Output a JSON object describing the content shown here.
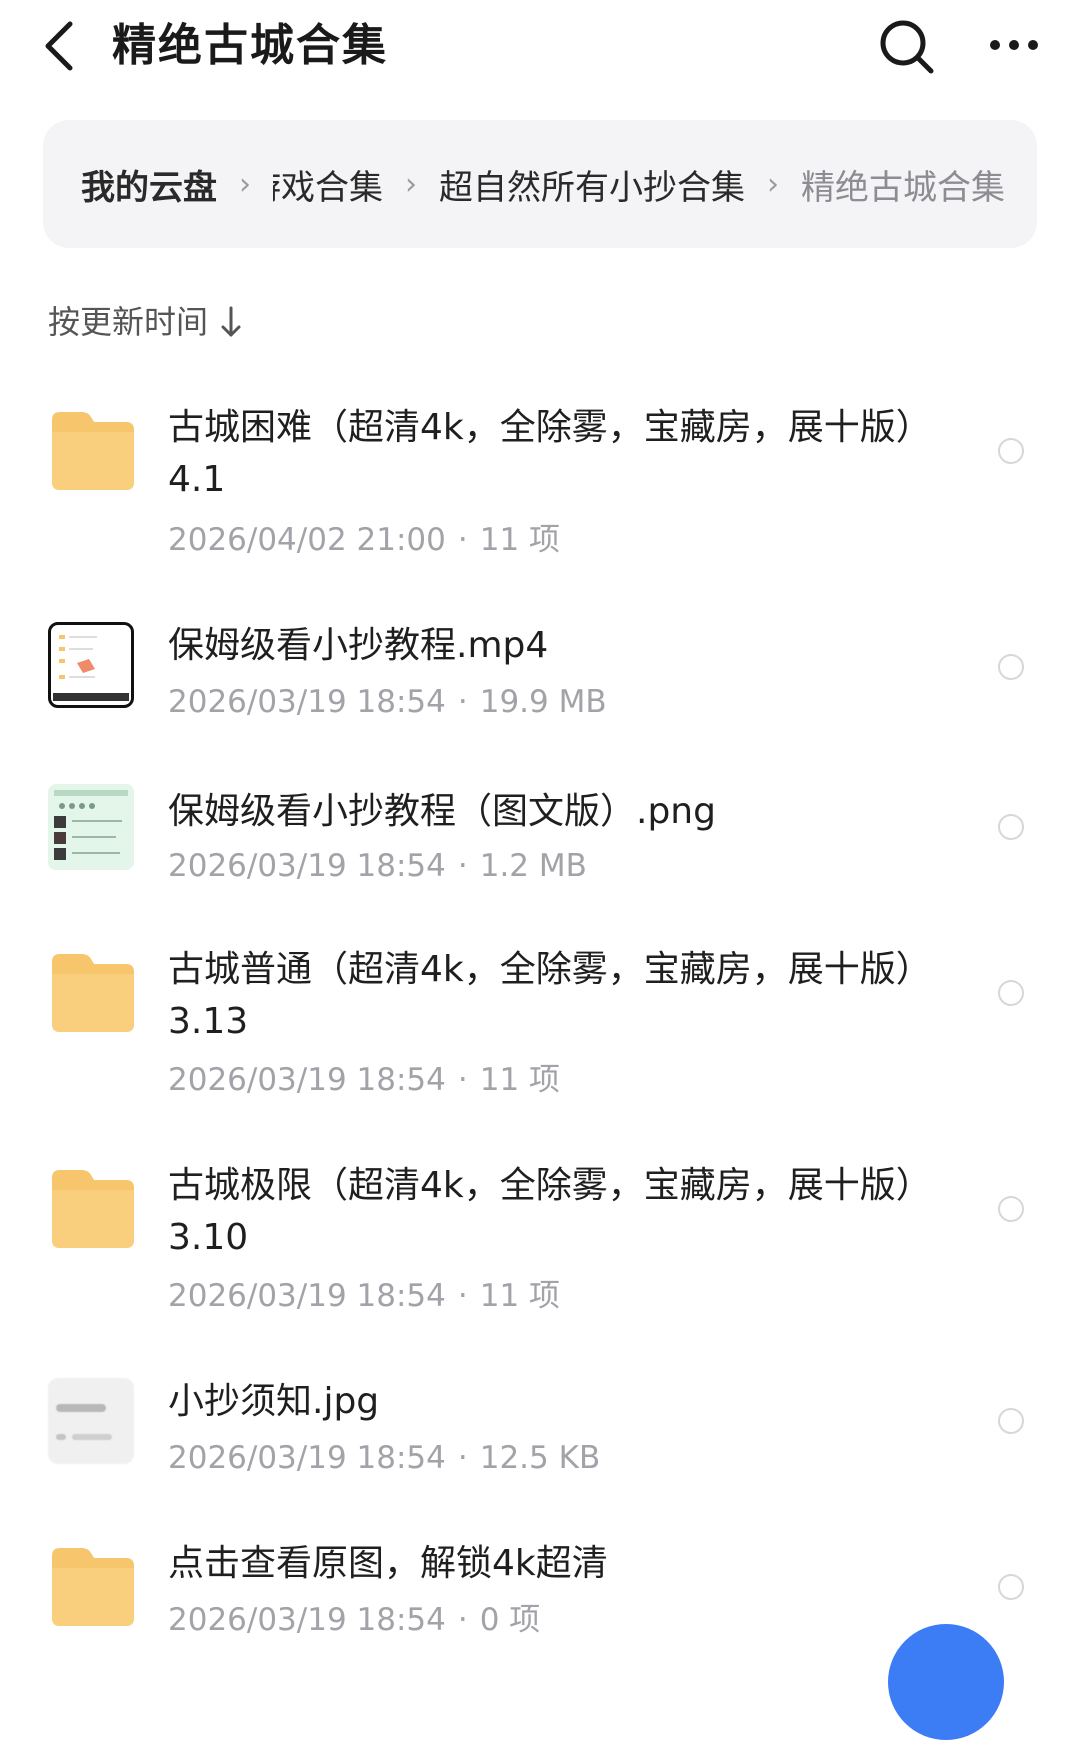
{
  "header": {
    "title": "精绝古城合集",
    "back_icon": "chevron-left-icon",
    "search_icon": "search-icon",
    "more_icon": "more-horizontal-icon"
  },
  "breadcrumb": {
    "items": [
      "我的云盘",
      "游戏合集",
      "超自然所有小抄合集",
      "精绝古城合集"
    ],
    "separator": "›"
  },
  "sort": {
    "label": "按更新时间",
    "icon": "arrow-down-icon"
  },
  "files": [
    {
      "type": "folder",
      "name": "古城困难（超清4k，全除雾，宝藏房，展十版）4.1",
      "date": "2026/04/02 21:00",
      "info": "11 项"
    },
    {
      "type": "video",
      "name": "保姆级看小抄教程.mp4",
      "date": "2026/03/19 18:54",
      "info": "19.9 MB"
    },
    {
      "type": "image-png",
      "name": "保姆级看小抄教程（图文版）.png",
      "date": "2026/03/19 18:54",
      "info": "1.2 MB"
    },
    {
      "type": "folder",
      "name": "古城普通（超清4k，全除雾，宝藏房，展十版）3.13",
      "date": "2026/03/19 18:54",
      "info": "11 项"
    },
    {
      "type": "folder",
      "name": "古城极限（超清4k，全除雾，宝藏房，展十版）3.10",
      "date": "2026/03/19 18:54",
      "info": "11 项"
    },
    {
      "type": "image-jpg",
      "name": "小抄须知.jpg",
      "date": "2026/03/19 18:54",
      "info": "12.5 KB"
    },
    {
      "type": "folder",
      "name": "点击查看原图，解锁4k超清",
      "date": "2026/03/19 18:54",
      "info": "0 项"
    }
  ],
  "colors": {
    "folder": "#f7c56b",
    "accent": "#3c7cf5",
    "breadcrumb_bg": "#f4f4f6",
    "meta_text": "#a2a2a8"
  }
}
